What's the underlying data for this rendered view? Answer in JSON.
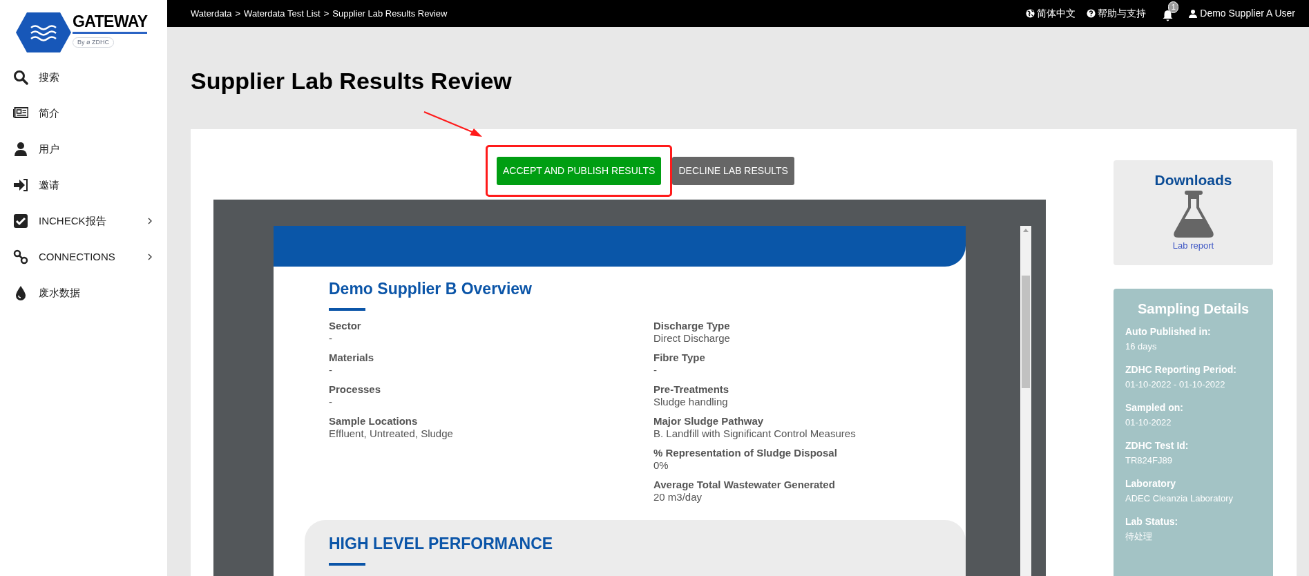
{
  "logo": {
    "title": "GATEWAY",
    "tagline": "By ø ZDHC"
  },
  "sidebar": {
    "items": [
      {
        "label": "搜索",
        "expandable": false
      },
      {
        "label": "简介",
        "expandable": false
      },
      {
        "label": "用户",
        "expandable": false
      },
      {
        "label": "邀请",
        "expandable": false
      },
      {
        "label": "INCHECK报告",
        "expandable": true
      },
      {
        "label": "CONNECTIONS",
        "expandable": true
      },
      {
        "label": "废水数据",
        "expandable": false
      }
    ]
  },
  "top_bar": {
    "breadcrumbs": [
      "Waterdata",
      ">",
      "Waterdata Test List",
      ">",
      "Supplier Lab Results Review"
    ],
    "language": "简体中文",
    "help": "帮助与支持",
    "notifications": "1",
    "user": "Demo Supplier A User"
  },
  "title": "Supplier Lab Results Review",
  "actions": [
    {
      "label": "ACCEPT AND PUBLISH RESULTS",
      "kind": "accept",
      "highlighted": true
    },
    {
      "label": "DECLINE LAB RESULTS",
      "kind": "decline",
      "highlighted": false
    }
  ],
  "document": {
    "heading": "Demo Supplier B Overview",
    "left_fields": [
      {
        "label": "Sector",
        "value": "-"
      },
      {
        "label": "Materials",
        "value": "-"
      },
      {
        "label": "Processes",
        "value": "-"
      },
      {
        "label": "Sample Locations",
        "value": "Effluent, Untreated, Sludge"
      }
    ],
    "right_fields": [
      {
        "label": "Discharge Type",
        "value": "Direct Discharge"
      },
      {
        "label": "Fibre Type",
        "value": "-"
      },
      {
        "label": "Pre-Treatments",
        "value": "Sludge handling"
      },
      {
        "label": "Major Sludge Pathway",
        "value": "B. Landfill with Significant Control Measures"
      },
      {
        "label": "% Representation of Sludge Disposal",
        "value": "0%"
      },
      {
        "label": "Average Total Wastewater Generated",
        "value": "20 m3/day"
      }
    ],
    "section_heading": "HIGH LEVEL PERFORMANCE"
  },
  "downloads": {
    "title": "Downloads",
    "link": "Lab report"
  },
  "sampling_details": {
    "title": "Sampling Details",
    "fields": [
      {
        "label": "Auto Published in:",
        "value": "16 days"
      },
      {
        "label": "ZDHC Reporting Period:",
        "value": "01-10-2022 - 01-10-2022"
      },
      {
        "label": "Sampled on:",
        "value": "01-10-2022"
      },
      {
        "label": "ZDHC Test Id:",
        "value": "TR824FJ89"
      },
      {
        "label": "Laboratory",
        "value": "ADEC Cleanzia Laboratory"
      },
      {
        "label": "Lab Status:",
        "value": "待处理"
      }
    ]
  }
}
